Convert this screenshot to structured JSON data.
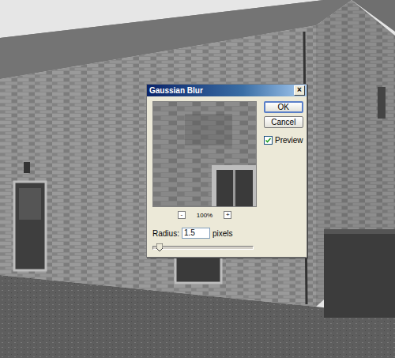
{
  "dialog": {
    "title": "Gaussian Blur",
    "close": "×"
  },
  "buttons": [
    {
      "label": "OK",
      "default": true
    },
    {
      "label": "Cancel",
      "default": false
    }
  ],
  "preview_option": {
    "label": "Preview",
    "checked": true
  },
  "zoom": {
    "minus": "-",
    "level": "100%",
    "plus": "+"
  },
  "radius": {
    "label": "Radius:",
    "value": "1.5",
    "unit": "pixels",
    "level": 0.06
  }
}
